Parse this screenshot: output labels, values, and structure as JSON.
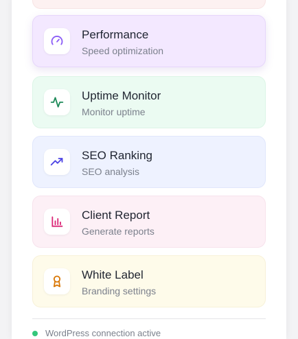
{
  "menu": {
    "items": [
      {
        "title": "Performance",
        "subtitle": "Speed optimization",
        "icon": "gauge-icon",
        "color": "#8b5cf6"
      },
      {
        "title": "Uptime Monitor",
        "subtitle": "Monitor uptime",
        "icon": "activity-icon",
        "color": "#1f8a5a"
      },
      {
        "title": "SEO Ranking",
        "subtitle": "SEO analysis",
        "icon": "trending-up-icon",
        "color": "#4f46e5"
      },
      {
        "title": "Client Report",
        "subtitle": "Generate reports",
        "icon": "bar-chart-icon",
        "color": "#db2777"
      },
      {
        "title": "White Label",
        "subtitle": "Branding settings",
        "icon": "award-icon",
        "color": "#d97706"
      }
    ]
  },
  "footer": {
    "status_text": "WordPress connection active",
    "status_color": "#34c77b"
  }
}
